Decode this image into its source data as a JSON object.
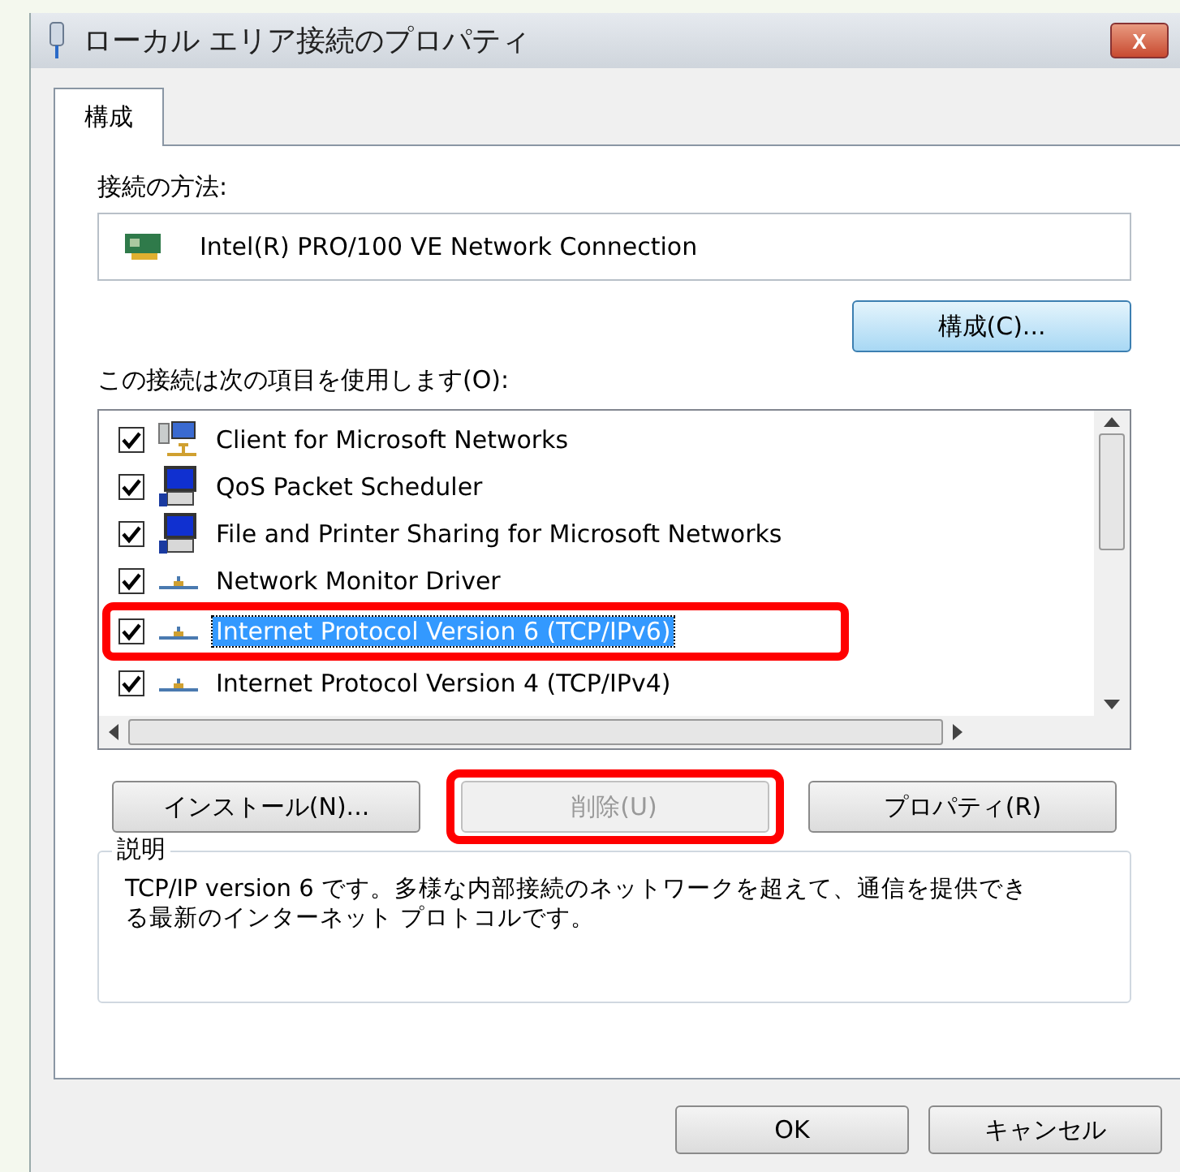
{
  "window": {
    "title": "ローカル エリア接続のプロパティ",
    "close": "X"
  },
  "tabs": [
    {
      "label": "構成",
      "selected": true
    }
  ],
  "connect_using": {
    "label": "接続の方法:",
    "adapter": "Intel(R) PRO/100 VE Network Connection",
    "button": "構成(C)..."
  },
  "items_label": "この接続は次の項目を使用します(O):",
  "items": [
    {
      "kind": "client",
      "label": "Client for Microsoft Networks",
      "checked": true,
      "selected": false,
      "annotated": false
    },
    {
      "kind": "computer",
      "label": "QoS Packet Scheduler",
      "checked": true,
      "selected": false,
      "annotated": false
    },
    {
      "kind": "computer",
      "label": "File and Printer Sharing for Microsoft Networks",
      "checked": true,
      "selected": false,
      "annotated": false
    },
    {
      "kind": "protocol",
      "label": "Network Monitor Driver",
      "checked": true,
      "selected": false,
      "annotated": false
    },
    {
      "kind": "protocol",
      "label": "Internet Protocol Version 6 (TCP/IPv6)",
      "checked": true,
      "selected": true,
      "annotated": true
    },
    {
      "kind": "protocol",
      "label": "Internet Protocol Version 4 (TCP/IPv4)",
      "checked": true,
      "selected": false,
      "annotated": false
    }
  ],
  "item_buttons": [
    {
      "label": "インストール(N)...",
      "disabled": false,
      "annotated": false
    },
    {
      "label": "削除(U)",
      "disabled": true,
      "annotated": true
    },
    {
      "label": "プロパティ(R)",
      "disabled": false,
      "annotated": false
    }
  ],
  "description": {
    "label": "説明",
    "text": "TCP/IP version 6 です。多様な内部接続のネットワークを超えて、通信を提供できる最新のインターネット プロトコルです。"
  },
  "buttons": [
    {
      "label": "OK"
    },
    {
      "label": "キャンセル"
    }
  ]
}
